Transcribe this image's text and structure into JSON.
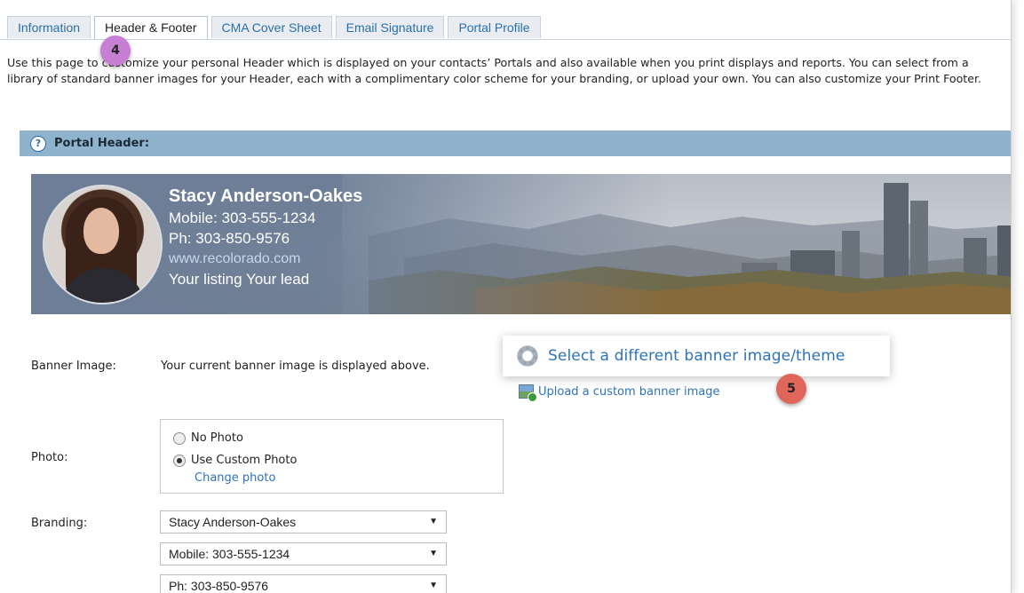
{
  "tabs": [
    "Information",
    "Header & Footer",
    "CMA Cover Sheet",
    "Email Signature",
    "Portal Profile"
  ],
  "intro": "Use this page to customize your personal Header which is displayed on your contacts’ Portals and also available when you print displays and reports. You can select from a library of standard banner images for your Header, each with a complimentary color scheme for your branding, or upload your own. You can also customize your Print Footer.",
  "section": {
    "title": "Portal Header:",
    "help": "?"
  },
  "banner": {
    "name": "Stacy Anderson-Oakes",
    "mobile": "Mobile: 303-555-1234",
    "phone": "Ph: 303-850-9576",
    "website": "www.recolorado.com",
    "tagline": "Your listing Your lead"
  },
  "form": {
    "banner_label": "Banner Image:",
    "banner_value": "Your current banner image is displayed above.",
    "select_banner_link": "Select a different banner image/theme",
    "upload_link": "Upload a custom banner image",
    "photo_label": "Photo:",
    "no_photo": "No Photo",
    "custom_photo": "Use Custom Photo",
    "change_photo": "Change photo",
    "branding_label": "Branding:",
    "branding_options": [
      "Stacy Anderson-Oakes",
      "Mobile: 303-555-1234",
      "Ph: 303-850-9576"
    ]
  },
  "badges": [
    {
      "label": "4",
      "color": "#c77fd4"
    },
    {
      "label": "5",
      "color": "#e0665a"
    }
  ],
  "colors": {
    "link": "#2e73b8",
    "section_bar": "#8fb3cd",
    "tab_bg": "#e9edf2"
  }
}
